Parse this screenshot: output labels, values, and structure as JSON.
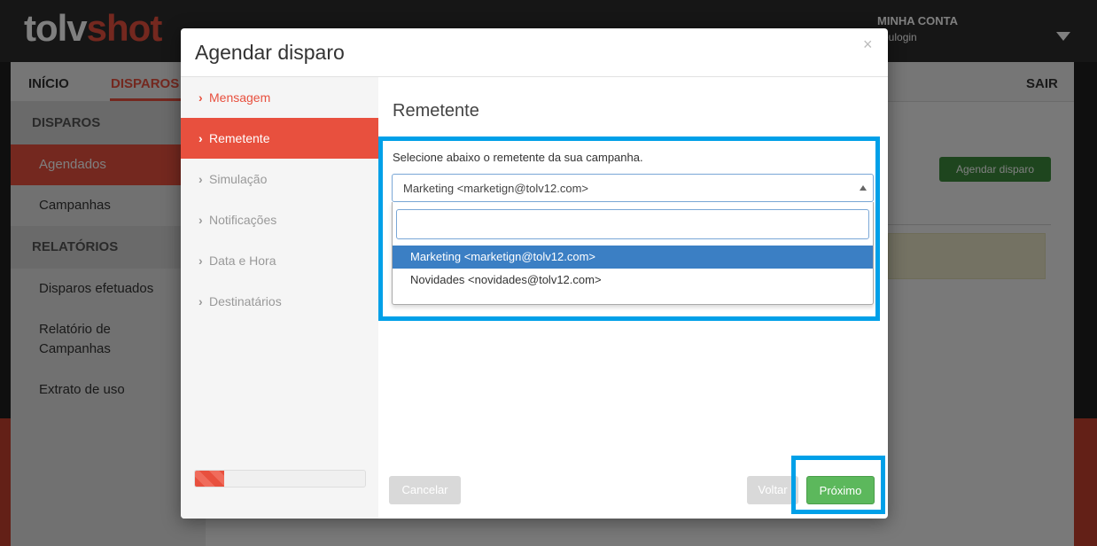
{
  "brand": {
    "part1": "tolv",
    "part2": "shot"
  },
  "account": {
    "title": "MINHA CONTA",
    "login": "seulogin"
  },
  "nav": {
    "inicio": "INÍCIO",
    "disparos": "DISPAROS",
    "sair": "SAIR"
  },
  "sidebar": {
    "section1": "DISPAROS",
    "items1": [
      "Agendados",
      "Campanhas"
    ],
    "section2": "RELATÓRIOS",
    "items2": [
      "Disparos efetuados",
      "Relatório de Campanhas",
      "Extrato de uso"
    ]
  },
  "main": {
    "schedule_button": "Agendar disparo"
  },
  "modal": {
    "title": "Agendar disparo",
    "close": "×",
    "steps": [
      "Mensagem",
      "Remetente",
      "Simulação",
      "Notificações",
      "Data e Hora",
      "Destinatários"
    ],
    "active_step": 1,
    "progress_fraction": 0.17,
    "section_title": "Remetente",
    "instruction": "Selecione abaixo o remetente da sua campanha.",
    "select": {
      "value": "Marketing <marketign@tolv12.com>",
      "search_value": "",
      "options": [
        "Marketing <marketign@tolv12.com>",
        "Novidades <novidades@tolv12.com>"
      ]
    },
    "buttons": {
      "cancel": "Cancelar",
      "back": "Voltar",
      "next": "Próximo"
    }
  },
  "colors": {
    "accent": "#e8503e",
    "success": "#5cb85c",
    "highlight": "#00a0e8",
    "selected": "#3b7fc4"
  }
}
